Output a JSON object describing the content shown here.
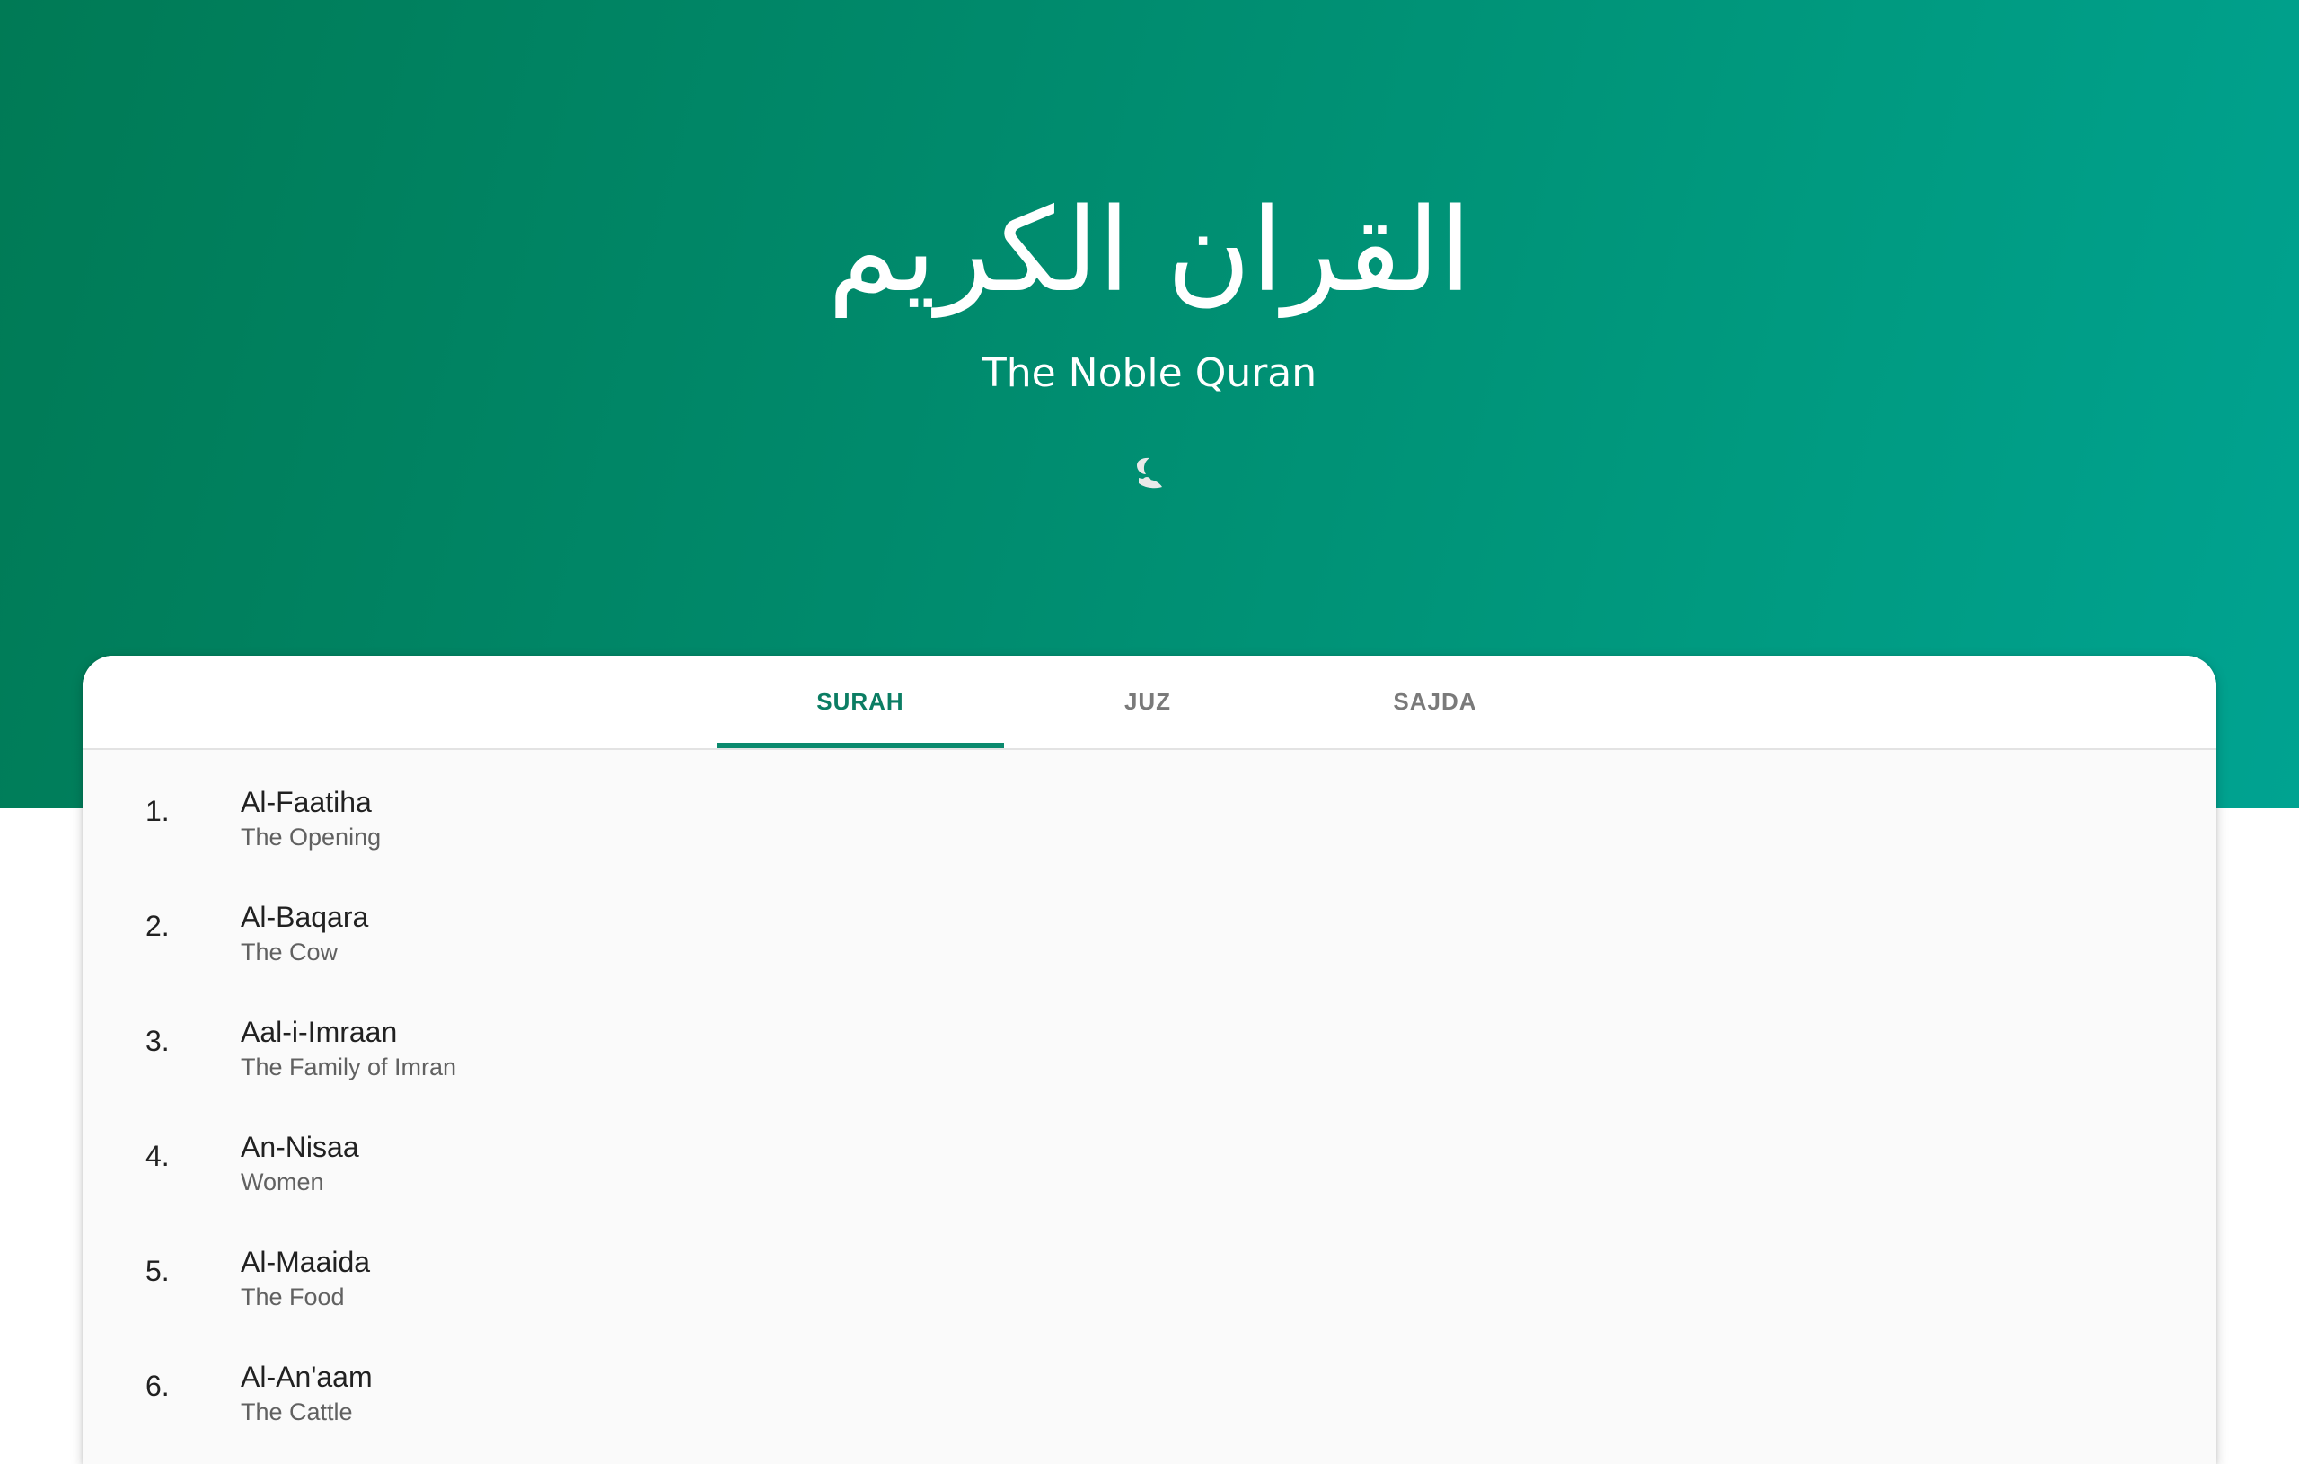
{
  "header": {
    "arabic_title": "القران الكريم",
    "subtitle": "The Noble Quran",
    "theme_toggle_icon": "moon-icon"
  },
  "tabs": [
    {
      "label": "SURAH",
      "active": true
    },
    {
      "label": "JUZ",
      "active": false
    },
    {
      "label": "SAJDA",
      "active": false
    }
  ],
  "surahs": [
    {
      "number": "1.",
      "name": "Al-Faatiha",
      "meaning": "The Opening"
    },
    {
      "number": "2.",
      "name": "Al-Baqara",
      "meaning": "The Cow"
    },
    {
      "number": "3.",
      "name": "Aal-i-Imraan",
      "meaning": "The Family of Imran"
    },
    {
      "number": "4.",
      "name": "An-Nisaa",
      "meaning": "Women"
    },
    {
      "number": "5.",
      "name": "Al-Maaida",
      "meaning": "The Food"
    },
    {
      "number": "6.",
      "name": "Al-An'aam",
      "meaning": "The Cattle"
    }
  ],
  "colors": {
    "accent": "#0b8a6e",
    "header_gradient_start": "#007a55",
    "header_gradient_end": "#00a391"
  }
}
